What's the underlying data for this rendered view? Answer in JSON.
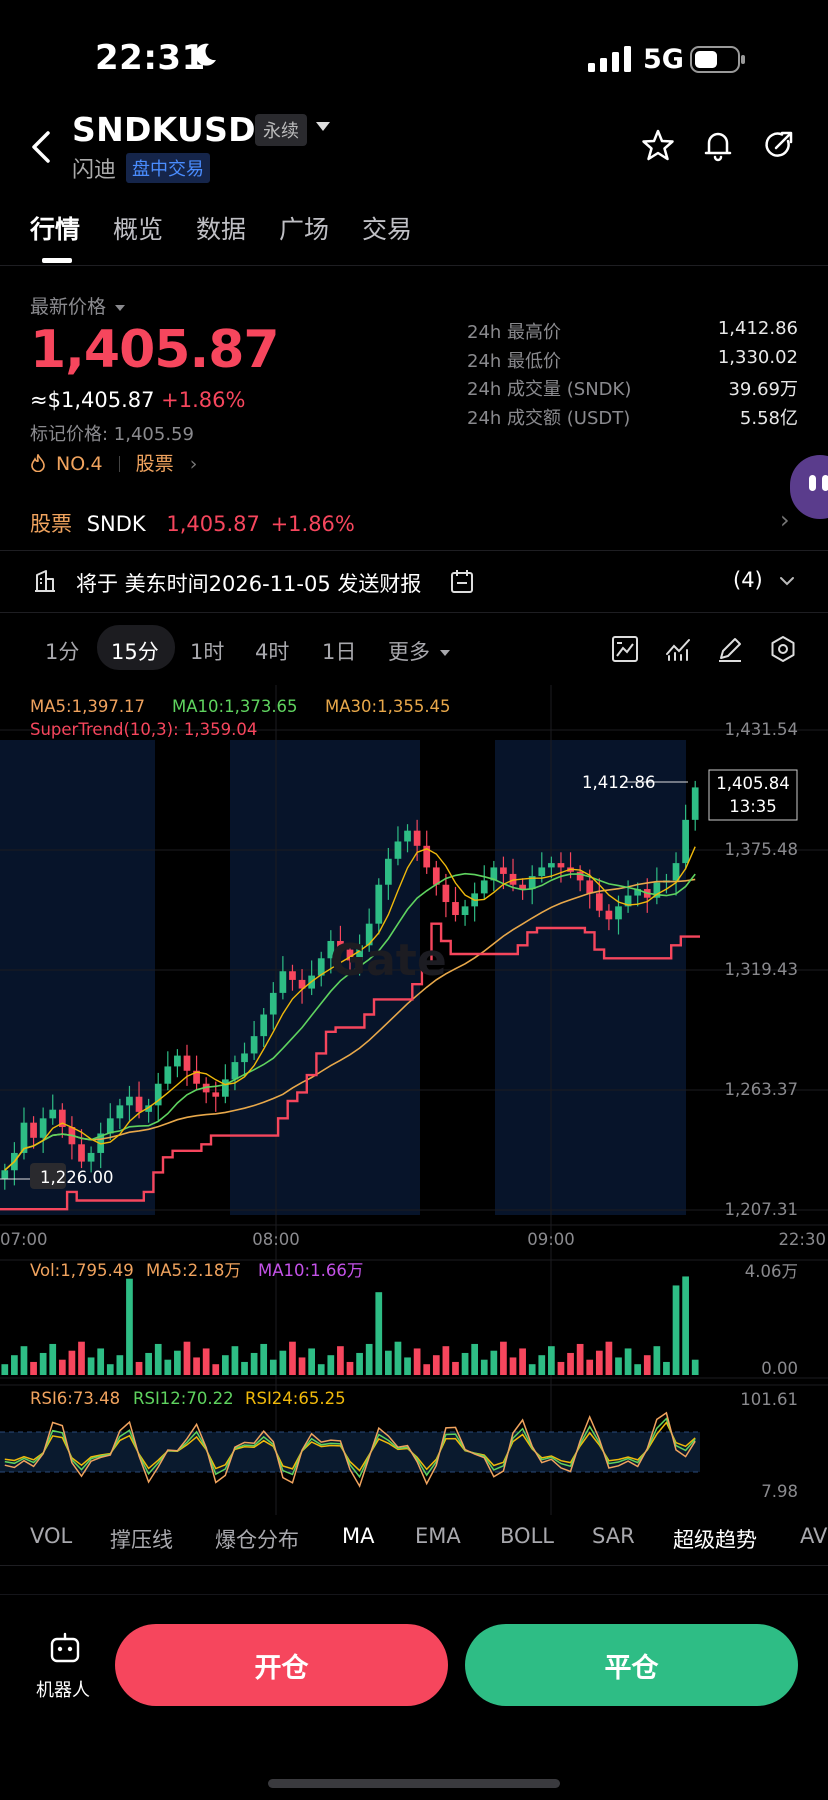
{
  "status_bar": {
    "time": "22:31",
    "network": "5G"
  },
  "header": {
    "symbol": "SNDKUSDT",
    "contract_type": "永续",
    "name": "闪迪",
    "session": "盘中交易"
  },
  "tabs": [
    "行情",
    "概览",
    "数据",
    "广场",
    "交易"
  ],
  "price": {
    "label": "最新价格",
    "last": "1,405.87",
    "approx_usd": "≈$1,405.87",
    "change": "+1.86%",
    "mark": "标记价格: 1,405.59",
    "rank": "NO.4",
    "category": "股票"
  },
  "stats": [
    {
      "label": "24h 最高价",
      "value": "1,412.86"
    },
    {
      "label": "24h 最低价",
      "value": "1,330.02"
    },
    {
      "label": "24h 成交量 (SNDK)",
      "value": "39.69万"
    },
    {
      "label": "24h 成交额 (USDT)",
      "value": "5.58亿"
    }
  ],
  "stock_row": {
    "label": "股票",
    "ticker": "SNDK",
    "price": "1,405.87",
    "change": "+1.86%"
  },
  "notice": {
    "text": "将于 美东时间2026-11-05 发送财报",
    "count": "(4)"
  },
  "timeframes": [
    "1分",
    "15分",
    "1时",
    "4时",
    "1日",
    "更多"
  ],
  "active_timeframe": "15分",
  "chart_legend": {
    "ma5": "MA5:1,397.17",
    "ma10": "MA10:1,373.65",
    "ma30": "MA30:1,355.45",
    "supertrend": "SuperTrend(10,3): 1,359.04",
    "vol": "Vol:1,795.49",
    "vol_ma5": "MA5:2.18万",
    "vol_ma10": "MA10:1.66万",
    "rsi6": "RSI6:73.48",
    "rsi12": "RSI12:70.22",
    "rsi24": "RSI24:65.25"
  },
  "chart_labels": {
    "price_axis": [
      "1,431.54",
      "1,375.48",
      "1,319.43",
      "1,263.37",
      "1,207.31"
    ],
    "time_axis": [
      "07:00",
      "08:00",
      "09:00",
      "22:30"
    ],
    "high_marker": "1,412.86",
    "low_marker": "1,226.00",
    "current_price": "1,405.84",
    "countdown": "13:35",
    "vol_axis": [
      "4.06万",
      "0.00"
    ],
    "rsi_axis": [
      "101.61",
      "7.98"
    ],
    "watermark": "Gate"
  },
  "indicator_tabs": [
    "VOL",
    "撑压线",
    "爆仓分布",
    "MA",
    "EMA",
    "BOLL",
    "SAR",
    "超级趋势",
    "AV"
  ],
  "bottom": {
    "robot_label": "机器人",
    "open_label": "开仓",
    "close_label": "平仓"
  },
  "colors": {
    "up": "#2ebd85",
    "down": "#f6465d",
    "ma5": "#f0b90b",
    "ma10": "#5fd35f",
    "ma30": "#e8a84a",
    "vol_ma10": "#c452e8"
  },
  "chart_data": {
    "type": "candlestick",
    "ylim": [
      1207.31,
      1431.54
    ],
    "y_ticks": [
      1431.54,
      1375.48,
      1319.43,
      1263.37,
      1207.31
    ],
    "x_ticks": [
      "07:00",
      "08:00",
      "09:00",
      "22:30"
    ],
    "series": [
      {
        "values": [
          1228,
          1236,
          1250,
          1243,
          1252,
          1256,
          1248,
          1240,
          1232,
          1236,
          1245,
          1252,
          1258,
          1262,
          1255,
          1258,
          1268,
          1276,
          1281,
          1274,
          1268,
          1264,
          1262,
          1270,
          1278,
          1282,
          1290,
          1300,
          1310,
          1320,
          1316,
          1312,
          1318,
          1326,
          1334,
          1330,
          1325,
          1332,
          1342,
          1360,
          1372,
          1380,
          1385,
          1378,
          1368,
          1360,
          1352,
          1346,
          1350,
          1356,
          1362,
          1368,
          1365,
          1360,
          1358,
          1364,
          1368,
          1370,
          1368,
          1366,
          1362,
          1356,
          1348,
          1344,
          1350,
          1355,
          1358,
          1354,
          1361,
          1362,
          1370,
          1390,
          1405
        ]
      }
    ],
    "volume": {
      "ylim": [
        0,
        40600
      ]
    },
    "rsi": {
      "ylim": [
        7.98,
        101.61
      ]
    }
  }
}
